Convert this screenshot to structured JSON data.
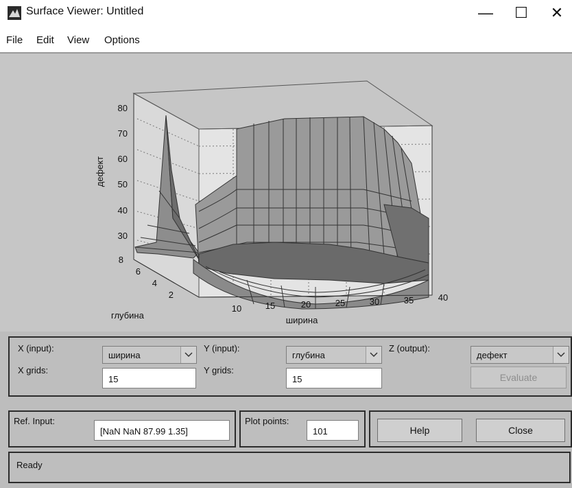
{
  "window": {
    "title": "Surface Viewer: Untitled",
    "minimize_glyph": "—",
    "maximize_glyph": "☐",
    "close_glyph": "✕"
  },
  "menu": [
    "File",
    "Edit",
    "View",
    "Options"
  ],
  "plot": {
    "z_axis_label": "дефект",
    "x_axis_label": "ширина",
    "y_axis_label": "глубина",
    "z_ticks": [
      "80",
      "70",
      "60",
      "50",
      "40",
      "30"
    ],
    "x_ticks": [
      "10",
      "15",
      "20",
      "25",
      "30",
      "35",
      "40"
    ],
    "y_ticks": [
      "8",
      "6",
      "4",
      "2"
    ]
  },
  "controls": {
    "x_input_label": "X (input):",
    "x_input_value": "ширина",
    "y_input_label": "Y (input):",
    "y_input_value": "глубина",
    "z_output_label": "Z (output):",
    "z_output_value": "дефект",
    "x_grids_label": "X grids:",
    "x_grids_value": "15",
    "y_grids_label": "Y grids:",
    "y_grids_value": "15",
    "evaluate_label": "Evaluate",
    "ref_input_label": "Ref. Input:",
    "ref_input_value": "[NaN NaN 87.99 1.35]",
    "plot_points_label": "Plot points:",
    "plot_points_value": "101",
    "help_label": "Help",
    "close_label": "Close"
  },
  "status": {
    "text": "Ready"
  },
  "colors": {
    "panel_bg": "#bebebe",
    "plot_bg": "#c6c6c6",
    "surface_dark": "#5e5e5e",
    "surface_light": "#9a9a9a"
  }
}
